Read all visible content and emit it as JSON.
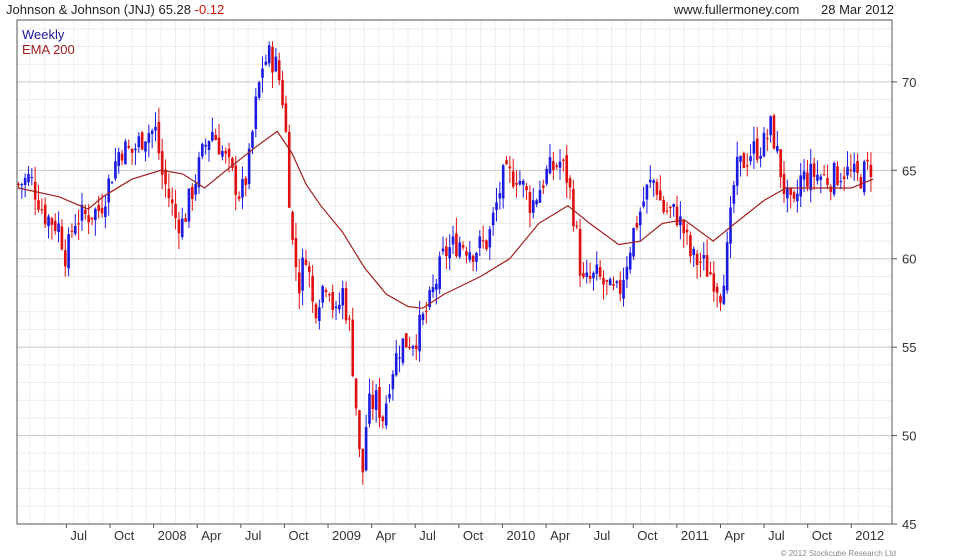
{
  "header": {
    "title": "Johnson & Johnson (JNJ) 65.28",
    "change": "-0.12",
    "site": "www.fullermoney.com",
    "date": "28 Mar 2012"
  },
  "footer": {
    "copyright": "© 2012 Stockcube Research Ltd"
  },
  "colors": {
    "up": "#1a1ae0",
    "down": "#e01010",
    "ema": "#a02020",
    "grid": "#d8d8d8"
  },
  "chart_data": {
    "type": "candlestick",
    "legend": [
      "Weekly",
      "EMA 200"
    ],
    "ylim": [
      45,
      73.5
    ],
    "y_ticks": [
      45,
      50,
      55,
      60,
      65,
      70
    ],
    "x_ticks": [
      {
        "label": "Jul",
        "t": 0.5
      },
      {
        "label": "Oct",
        "t": 3.5
      },
      {
        "label": "2008",
        "t": 6.5
      },
      {
        "label": "Apr",
        "t": 9.5
      },
      {
        "label": "Jul",
        "t": 12.5
      },
      {
        "label": "Oct",
        "t": 15.5
      },
      {
        "label": "2009",
        "t": 18.5
      },
      {
        "label": "Apr",
        "t": 21.5
      },
      {
        "label": "Jul",
        "t": 24.5
      },
      {
        "label": "Oct",
        "t": 27.5
      },
      {
        "label": "2010",
        "t": 30.5
      },
      {
        "label": "Apr",
        "t": 33.5
      },
      {
        "label": "Jul",
        "t": 36.5
      },
      {
        "label": "Oct",
        "t": 39.5
      },
      {
        "label": "2011",
        "t": 42.5
      },
      {
        "label": "Apr",
        "t": 45.5
      },
      {
        "label": "Jul",
        "t": 48.5
      },
      {
        "label": "Oct",
        "t": 51.5
      },
      {
        "label": "2012",
        "t": 54.5
      }
    ],
    "x_range": [
      -2.9,
      57.3
    ],
    "weekly_close": [
      [
        -2.8,
        64.2
      ],
      [
        -2.0,
        64.6
      ],
      [
        -1.0,
        62.5
      ],
      [
        0,
        61.8
      ],
      [
        0.5,
        60.0
      ],
      [
        1.0,
        62.2
      ],
      [
        2.0,
        62.5
      ],
      [
        2.8,
        62.8
      ],
      [
        3.5,
        64.5
      ],
      [
        4.2,
        66.3
      ],
      [
        5.0,
        66.0
      ],
      [
        6.0,
        67.2
      ],
      [
        6.7,
        67.2
      ],
      [
        7.0,
        65.0
      ],
      [
        8.0,
        62.3
      ],
      [
        8.5,
        62.0
      ],
      [
        9.2,
        64.0
      ],
      [
        10.0,
        66.3
      ],
      [
        10.5,
        67.3
      ],
      [
        11.0,
        66.5
      ],
      [
        12.0,
        64.5
      ],
      [
        12.5,
        63.5
      ],
      [
        13.0,
        65.0
      ],
      [
        13.5,
        68.5
      ],
      [
        14.0,
        71.0
      ],
      [
        14.5,
        71.5
      ],
      [
        15.0,
        70.8
      ],
      [
        15.5,
        68.5
      ],
      [
        16.0,
        61.2
      ],
      [
        16.5,
        58.5
      ],
      [
        17.0,
        60.5
      ],
      [
        17.5,
        57.0
      ],
      [
        18.0,
        58.2
      ],
      [
        18.5,
        59.0
      ],
      [
        19.0,
        56.5
      ],
      [
        19.5,
        58.2
      ],
      [
        20.0,
        56.0
      ],
      [
        20.5,
        51.0
      ],
      [
        20.8,
        47.0
      ],
      [
        21.2,
        51.5
      ],
      [
        21.8,
        52.0
      ],
      [
        22.3,
        51.0
      ],
      [
        22.8,
        53.5
      ],
      [
        23.5,
        55.2
      ],
      [
        24.5,
        55.5
      ],
      [
        25.5,
        57.5
      ],
      [
        26.5,
        60.3
      ],
      [
        27.5,
        61.0
      ],
      [
        28.5,
        60.5
      ],
      [
        29.5,
        61.0
      ],
      [
        30.5,
        64.5
      ],
      [
        31.5,
        64.8
      ],
      [
        32.5,
        63.0
      ],
      [
        33.5,
        64.8
      ],
      [
        34.5,
        65.5
      ],
      [
        35.0,
        64.5
      ],
      [
        35.5,
        62.0
      ],
      [
        36.0,
        58.5
      ],
      [
        37.0,
        59.0
      ],
      [
        38.0,
        58.0
      ],
      [
        38.5,
        58.0
      ],
      [
        39.5,
        61.5
      ],
      [
        40.5,
        64.0
      ],
      [
        41.0,
        64.5
      ],
      [
        41.5,
        62.8
      ],
      [
        42.5,
        62.5
      ],
      [
        43.0,
        61.5
      ],
      [
        43.5,
        60.0
      ],
      [
        44.2,
        59.8
      ],
      [
        45.0,
        59.0
      ],
      [
        45.5,
        58.2
      ],
      [
        46.0,
        60.5
      ],
      [
        46.5,
        64.8
      ],
      [
        47.5,
        66.0
      ],
      [
        48.5,
        66.5
      ],
      [
        49.0,
        67.5
      ],
      [
        49.5,
        65.5
      ],
      [
        50.0,
        63.5
      ],
      [
        50.5,
        62.5
      ],
      [
        51.0,
        64.5
      ],
      [
        52.0,
        64.8
      ],
      [
        53.0,
        64.5
      ],
      [
        54.0,
        65.0
      ],
      [
        55.0,
        64.5
      ],
      [
        55.5,
        65.0
      ],
      [
        56.0,
        65.3
      ]
    ],
    "ema_200": [
      [
        -2.8,
        64.0
      ],
      [
        0,
        63.5
      ],
      [
        2.0,
        62.8
      ],
      [
        3.0,
        63.5
      ],
      [
        5.0,
        64.5
      ],
      [
        7.0,
        65.0
      ],
      [
        8.5,
        64.8
      ],
      [
        10.0,
        64.0
      ],
      [
        11.5,
        65.0
      ],
      [
        13.5,
        66.3
      ],
      [
        15.0,
        67.2
      ],
      [
        16.0,
        66.0
      ],
      [
        17.0,
        64.2
      ],
      [
        18.0,
        63.0
      ],
      [
        19.5,
        61.5
      ],
      [
        21.0,
        59.5
      ],
      [
        22.5,
        58.0
      ],
      [
        24.0,
        57.3
      ],
      [
        25.0,
        57.2
      ],
      [
        26.5,
        58.0
      ],
      [
        29.0,
        59.0
      ],
      [
        31.0,
        60.0
      ],
      [
        33.0,
        62.0
      ],
      [
        35.0,
        63.0
      ],
      [
        36.5,
        62.0
      ],
      [
        38.5,
        60.8
      ],
      [
        40.0,
        61.0
      ],
      [
        41.5,
        62.0
      ],
      [
        43.0,
        62.2
      ],
      [
        45.0,
        61.0
      ],
      [
        46.5,
        62.0
      ],
      [
        48.5,
        63.3
      ],
      [
        50.0,
        64.0
      ],
      [
        52.0,
        64.0
      ],
      [
        54.5,
        64.0
      ],
      [
        56.0,
        64.5
      ]
    ]
  }
}
